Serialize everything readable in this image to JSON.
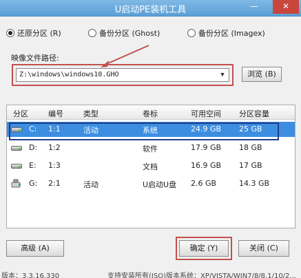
{
  "window": {
    "title": "U启动PE装机工具",
    "minimize": "—",
    "close": "✕"
  },
  "modes": [
    {
      "label": "还原分区 (R)",
      "selected": true
    },
    {
      "label": "备份分区 (Ghost)",
      "selected": false
    },
    {
      "label": "备份分区 (Imagex)",
      "selected": false
    }
  ],
  "image_path": {
    "label": "映像文件路径:",
    "value": "Z:\\windows\\windows10.GHO",
    "browse_label": "浏览 (B)"
  },
  "table": {
    "headers": [
      "分区",
      "编号",
      "类型",
      "卷标",
      "可用空间",
      "分区容量"
    ],
    "rows": [
      {
        "drive": "C:",
        "num": "1:1",
        "type": "活动",
        "label": "系统",
        "free": "24.9 GB",
        "size": "25 GB",
        "icon": "hard-drive-icon"
      },
      {
        "drive": "D:",
        "num": "1:2",
        "type": "",
        "label": "软件",
        "free": "17.9 GB",
        "size": "18 GB",
        "icon": "hard-drive-icon"
      },
      {
        "drive": "E:",
        "num": "1:3",
        "type": "",
        "label": "文档",
        "free": "16.9 GB",
        "size": "17 GB",
        "icon": "hard-drive-icon"
      },
      {
        "drive": "G:",
        "num": "2:1",
        "type": "活动",
        "label": "U启动U盘",
        "free": "2.6 GB",
        "size": "14.3 GB",
        "icon": "usb-drive-icon"
      }
    ]
  },
  "buttons": {
    "advanced": "高级 (A)",
    "confirm": "确定 (Y)",
    "close": "关闭 (C)"
  },
  "status": {
    "version": "版本：3.3.16.330",
    "support": "支持安装所有(ISO)版本系统：XP/VISTA/WIN7/8/8.1/10/2..."
  },
  "colors": {
    "accent": "#3d8ee0",
    "highlight_red": "#c0504d",
    "highlight_navy": "#1f3d8a"
  }
}
